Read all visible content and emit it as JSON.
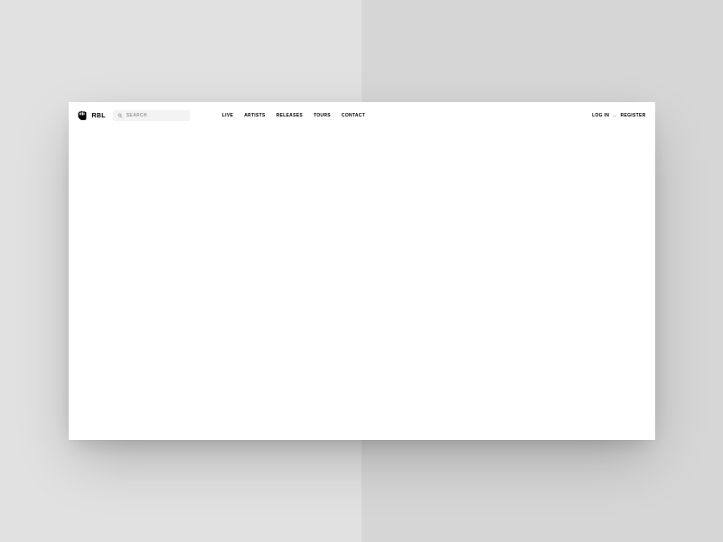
{
  "brand": {
    "name": "RBL"
  },
  "search": {
    "placeholder": "SEARCH"
  },
  "nav": {
    "items": [
      {
        "label": "LIVE"
      },
      {
        "label": "ARTISTS"
      },
      {
        "label": "RELEASES"
      },
      {
        "label": "TOURS"
      },
      {
        "label": "CONTACT"
      }
    ]
  },
  "auth": {
    "login_label": "LOG IN",
    "separator": "or",
    "register_label": "REGISTER"
  }
}
